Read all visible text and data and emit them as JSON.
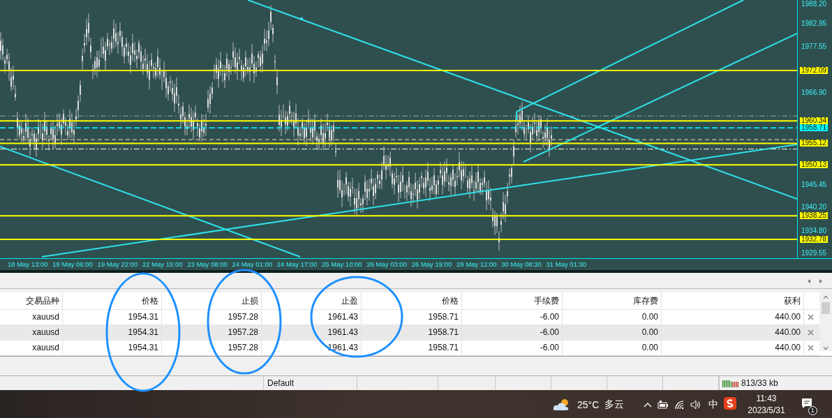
{
  "chart": {
    "price_axis": [
      "1988.20",
      "1982.95",
      "1977.55",
      "1966.90",
      "1945.45",
      "1940.20",
      "1934.80",
      "1929.55"
    ],
    "price_lines": [
      {
        "price": "1972.09",
        "kind": "solid",
        "color": "#ffff00"
      },
      {
        "price": "1960.34",
        "kind": "solid",
        "color": "#ffff00"
      },
      {
        "price": "1958.71",
        "kind": "dashed",
        "color": "#00ffff"
      },
      {
        "price": "1955.12",
        "kind": "solid",
        "color": "#ffff00"
      },
      {
        "price": "1950.13",
        "kind": "solid",
        "color": "#ffff00"
      },
      {
        "price": "1938.25",
        "kind": "solid",
        "color": "#ffff00"
      },
      {
        "price": "1932.78",
        "kind": "solid",
        "color": "#ffff00"
      }
    ],
    "time_axis": [
      "18 May 13:00",
      "19 May 06:00",
      "19 May 22:00",
      "22 May 15:00",
      "23 May 08:00",
      "24 May 01:00",
      "24 May 17:00",
      "25 May 10:00",
      "26 May 03:00",
      "26 May 19:00",
      "29 May 12:00",
      "30 May 08:30",
      "31 May 01:30"
    ]
  },
  "trade_table": {
    "columns": [
      "交易品种",
      "价格",
      "止损",
      "止盈",
      "价格",
      "手续费",
      "库存费",
      "获利"
    ],
    "rows": [
      {
        "cells": [
          "xauusd",
          "1954.31",
          "1957.28",
          "1961.43",
          "1958.71",
          "-6.00",
          "0.00",
          "440.00"
        ]
      },
      {
        "cells": [
          "xauusd",
          "1954.31",
          "1957.28",
          "1961.43",
          "1958.71",
          "-6.00",
          "0.00",
          "440.00"
        ]
      },
      {
        "cells": [
          "xauusd",
          "1954.31",
          "1957.28",
          "1961.43",
          "1958.71",
          "-6.00",
          "0.00",
          "440.00"
        ]
      }
    ]
  },
  "status_bar": {
    "profile": "Default",
    "traffic": "813/33 kb"
  },
  "taskbar": {
    "temperature": "25°C",
    "weather": "多云",
    "ime": "中",
    "time": "11:43",
    "date": "2023/5/31",
    "notification_count": "1"
  }
}
